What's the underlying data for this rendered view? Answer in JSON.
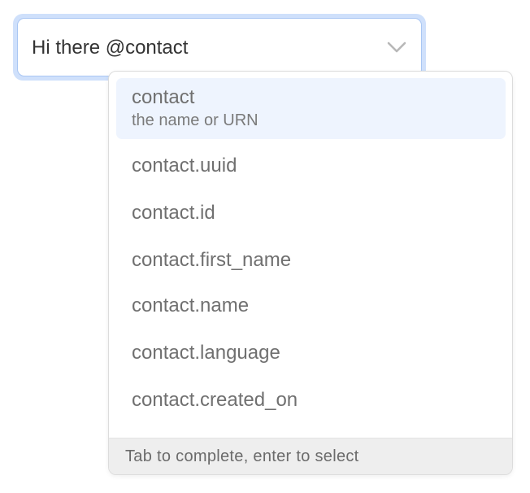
{
  "input": {
    "value": "Hi there @contact",
    "toggle_icon": "chevron-down-icon"
  },
  "completion": {
    "options": [
      {
        "name": "contact",
        "description": "the name or URN",
        "selected": true
      },
      {
        "name": "contact.uuid"
      },
      {
        "name": "contact.id"
      },
      {
        "name": "contact.first_name"
      },
      {
        "name": "contact.name"
      },
      {
        "name": "contact.language"
      },
      {
        "name": "contact.created_on"
      }
    ],
    "footer": "Tab to complete, enter to select"
  },
  "colors": {
    "focus_ring": "#cfe0fb",
    "input_border": "#a9c6f3",
    "selected_bg": "#eef4fe",
    "option_text": "#707070",
    "footer_bg": "#eeeeee"
  }
}
